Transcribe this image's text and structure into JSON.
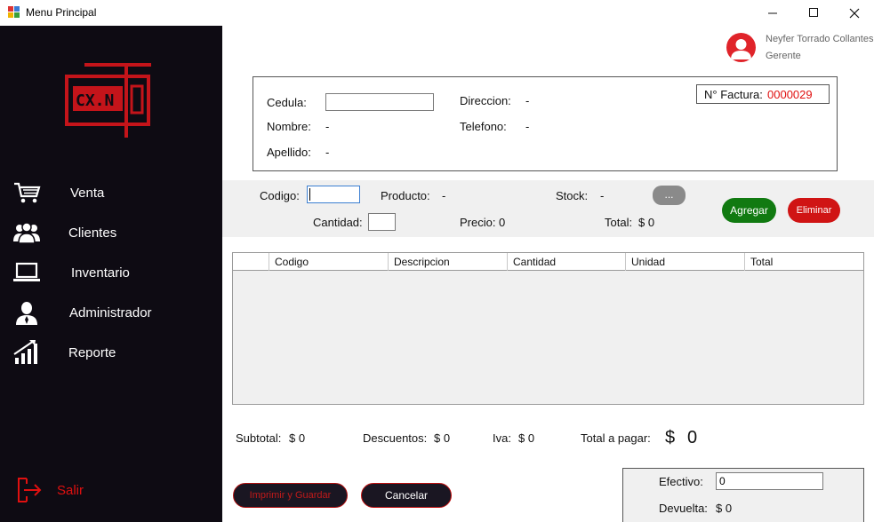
{
  "window": {
    "title": "Menu Principal",
    "minimize": "—",
    "maximize": "☐",
    "close": "✕"
  },
  "sidebar": {
    "logo_text": "CX.N",
    "items": [
      {
        "label": "Venta",
        "icon": "cart-icon"
      },
      {
        "label": "Clientes",
        "icon": "users-icon"
      },
      {
        "label": "Inventario",
        "icon": "laptop-icon"
      },
      {
        "label": "Administrador",
        "icon": "admin-icon"
      },
      {
        "label": "Reporte",
        "icon": "chart-icon"
      }
    ],
    "logout": {
      "label": "Salir",
      "icon": "logout-icon"
    }
  },
  "user": {
    "name": "Neyfer Torrado Collantes",
    "role": "Gerente"
  },
  "client": {
    "cedula_label": "Cedula:",
    "cedula_value": "",
    "nombre_label": "Nombre:",
    "nombre_value": "-",
    "apellido_label": "Apellido:",
    "apellido_value": "-",
    "direccion_label": "Direccion:",
    "direccion_value": "-",
    "telefono_label": "Telefono:",
    "telefono_value": "-",
    "factura_label": "N° Factura:",
    "factura_value": "0000029"
  },
  "product": {
    "codigo_label": "Codigo:",
    "codigo_value": "",
    "producto_label": "Producto:",
    "producto_value": "-",
    "stock_label": "Stock:",
    "stock_value": "-",
    "browse_button": "...",
    "cantidad_label": "Cantidad:",
    "cantidad_value": "",
    "precio_label": "Precio:",
    "precio_value": "0",
    "total_label": "Total:",
    "total_value": "$ 0",
    "agregar_button": "Agregar",
    "eliminar_button": "Eliminar"
  },
  "grid": {
    "columns": [
      "",
      "Codigo",
      "Descripcion",
      "Cantidad",
      "Unidad",
      "Total"
    ],
    "rows": []
  },
  "totals": {
    "subtotal_label": "Subtotal:",
    "subtotal_value": "$ 0",
    "descuentos_label": "Descuentos:",
    "descuentos_value": "$ 0",
    "iva_label": "Iva:",
    "iva_value": "$ 0",
    "pagar_label": "Total a pagar:",
    "pagar_currency": "$",
    "pagar_value": "0"
  },
  "actions": {
    "imprimir_button": "Imprimir y Guardar",
    "cancelar_button": "Cancelar"
  },
  "payment": {
    "efectivo_label": "Efectivo:",
    "efectivo_value": "0",
    "devuelta_label": "Devuelta:",
    "devuelta_value": "$ 0"
  },
  "colors": {
    "sidebar_bg": "#0e0b13",
    "accent_red": "#e01010",
    "agregar_green": "#117a11",
    "eliminar_red": "#d01414"
  }
}
